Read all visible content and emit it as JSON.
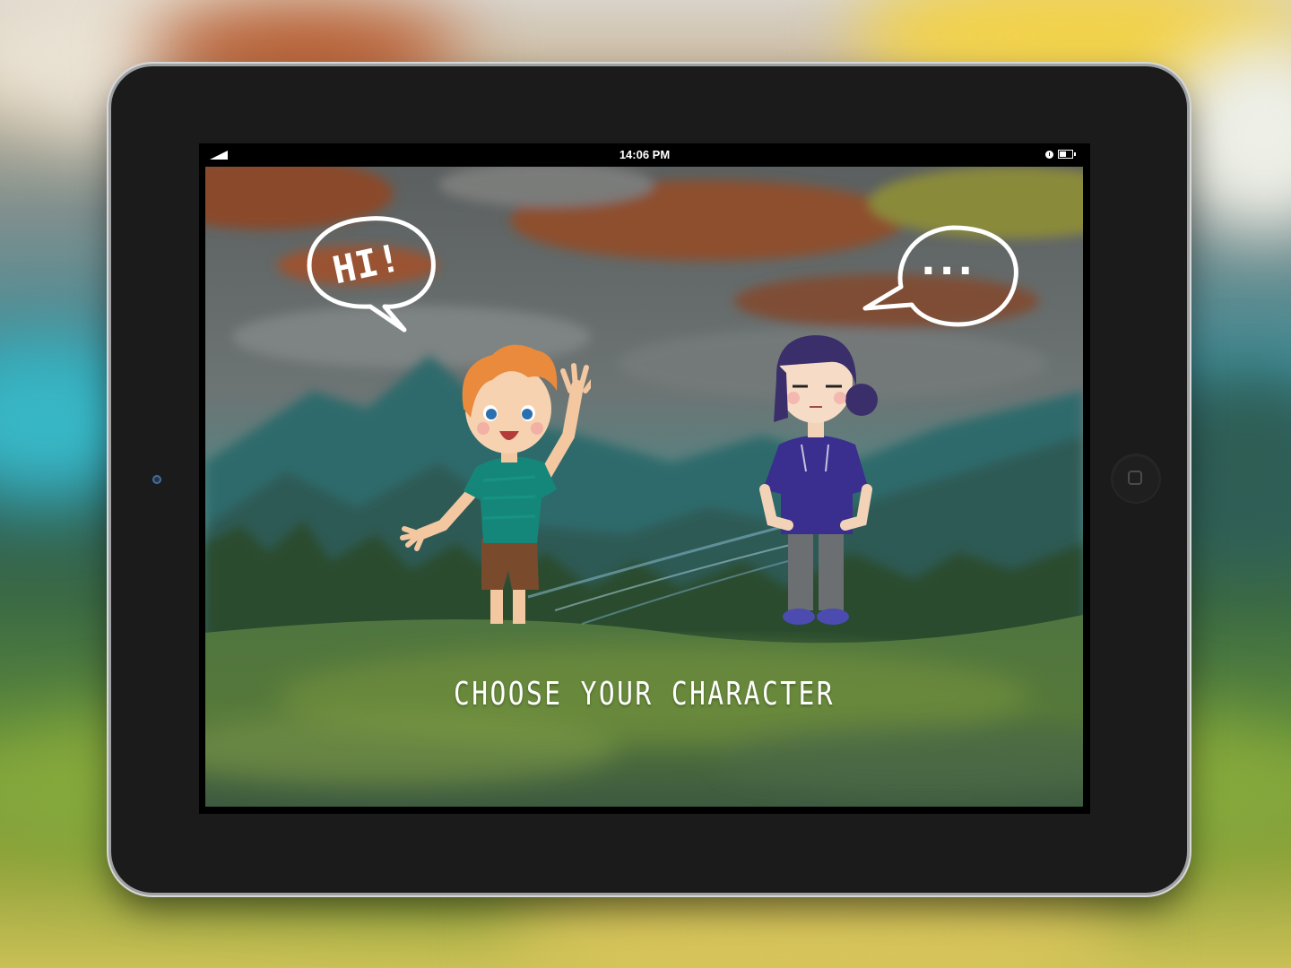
{
  "status_bar": {
    "time": "14:06 PM"
  },
  "speech": {
    "boy": "HI!",
    "girl": "..."
  },
  "screen": {
    "title": "CHOOSE YOUR CHARACTER"
  },
  "characters": [
    {
      "id": "boy",
      "hair_color": "#e98a3c",
      "shirt_color": "#15877a",
      "shorts_color": "#7a4a2c"
    },
    {
      "id": "girl",
      "hair_color": "#3a2f6a",
      "shirt_color": "#3a2f8e",
      "pants_color": "#6b6f72"
    }
  ],
  "colors": {
    "sky": "#6f8f8c",
    "grass": "#4f7a3a",
    "bezel": "#1b1b1b"
  }
}
